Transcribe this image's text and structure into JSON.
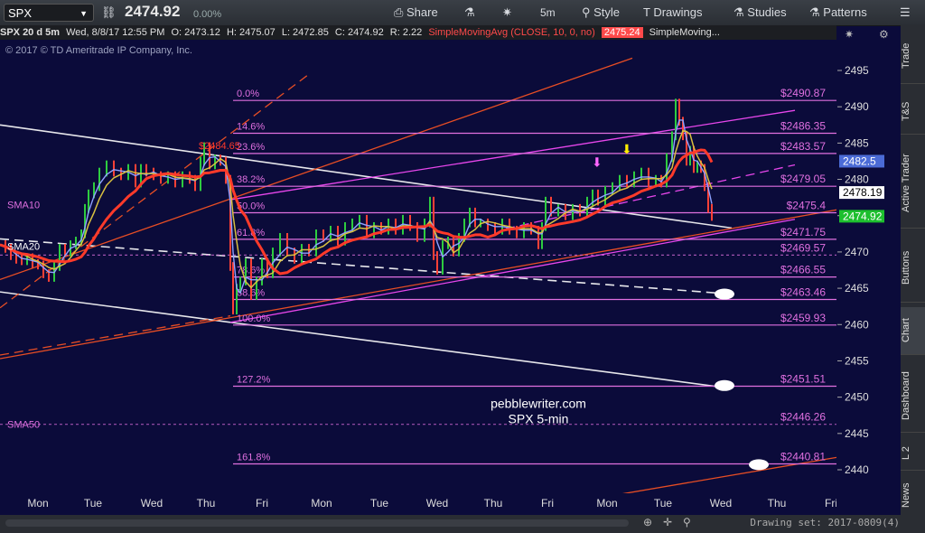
{
  "toolbar": {
    "symbol": "SPX",
    "last_price": "2474.92",
    "change_pct": "0.00%",
    "buttons": [
      "Share",
      "5m",
      "Style",
      "Drawings",
      "Studies",
      "Patterns"
    ]
  },
  "infobar": {
    "chart_desc": "SPX 20 d 5m",
    "datetime": "Wed, 8/8/17 12:55 PM",
    "open": "O: 2473.12",
    "high": "H: 2475.07",
    "low": "L: 2472.85",
    "close": "C: 2474.92",
    "range": "R: 2.22",
    "sma_label": "SimpleMovingAvg (CLOSE, 10, 0, no)",
    "sma_value": "2475.24",
    "sma2_label": "SimpleMoving..."
  },
  "copyright": "© 2017 © TD Ameritrade IP Company, Inc.",
  "watermark": [
    "pebblewriter.com",
    "SPX 5-min"
  ],
  "side_tabs": [
    "Trade",
    "T&S",
    "Active Trader",
    "Buttons",
    "Chart",
    "Dashboard",
    "L 2",
    "News"
  ],
  "drawing_set": "Drawing set: 2017-0809(4)",
  "colors": {
    "background": "#0b0b3a",
    "fib": "#e070e0",
    "sma10": "#ff3a2a",
    "price_badge": "#1dbf2e",
    "accent_blue": "#4b6bd6"
  },
  "chart_data": {
    "type": "line",
    "y_ticks": [
      2440,
      2445,
      2450,
      2455,
      2460,
      2465,
      2470,
      2475,
      2480,
      2485,
      2490,
      2495
    ],
    "ylim": [
      2437.5,
      2497.5
    ],
    "x_labels": [
      "Mon",
      "Tue",
      "Wed",
      "Thu",
      "Fri",
      "Mon",
      "Tue",
      "Wed",
      "Thu",
      "Fri",
      "Mon",
      "Tue",
      "Wed",
      "Thu",
      "Fri"
    ],
    "fib_levels": [
      {
        "pct": "0.0%",
        "price": 2490.87,
        "label": "$2490.87"
      },
      {
        "pct": "14.6%",
        "price": 2486.35,
        "label": "$2486.35"
      },
      {
        "pct": "23.6%",
        "price": 2483.57,
        "label": "$2483.57"
      },
      {
        "pct": "38.2%",
        "price": 2479.05,
        "label": "$2479.05"
      },
      {
        "pct": "50.0%",
        "price": 2475.4,
        "label": "$2475.4"
      },
      {
        "pct": "61.8%",
        "price": 2471.75,
        "label": "$2471.75"
      },
      {
        "pct": "",
        "price": 2469.57,
        "label": "$2469.57"
      },
      {
        "pct": "78.6%",
        "price": 2466.55,
        "label": "$2466.55"
      },
      {
        "pct": "88.6%",
        "price": 2463.46,
        "label": "$2463.46"
      },
      {
        "pct": "100.0%",
        "price": 2459.93,
        "label": "$2459.93"
      },
      {
        "pct": "127.2%",
        "price": 2451.51,
        "label": "$2451.51"
      },
      {
        "pct": "",
        "price": 2446.26,
        "label": "$2446.26"
      },
      {
        "pct": "161.8%",
        "price": 2440.81,
        "label": "$2440.81"
      }
    ],
    "sma_labels": [
      {
        "name": "SMA10",
        "price": 2476.5
      },
      {
        "name": "SMA20",
        "price": 2470.8
      },
      {
        "name": "SMA50",
        "price": 2446.3
      }
    ],
    "annotation": {
      "label": "$2484.65",
      "price": 2484.65
    },
    "price_badges": [
      {
        "value": "2482.5",
        "price": 2482.5,
        "color": "#4b6bd6"
      },
      {
        "value": "2478.19",
        "price": 2478.19,
        "color": "#ffffff"
      },
      {
        "value": "2474.92",
        "price": 2474.92,
        "color": "#1dbf2e"
      }
    ],
    "price_path": [
      [
        0,
        2471
      ],
      [
        6,
        2470.5
      ],
      [
        12,
        2469.5
      ],
      [
        18,
        2469
      ],
      [
        24,
        2468.8
      ],
      [
        30,
        2469.2
      ],
      [
        36,
        2468.4
      ],
      [
        42,
        2468.2
      ],
      [
        48,
        2467
      ],
      [
        54,
        2466.5
      ],
      [
        60,
        2468
      ],
      [
        66,
        2470.5
      ],
      [
        72,
        2470
      ],
      [
        78,
        2471
      ],
      [
        84,
        2471.5
      ],
      [
        90,
        2472.5
      ],
      [
        94,
        2476
      ],
      [
        98,
        2478
      ],
      [
        104,
        2479
      ],
      [
        110,
        2481
      ],
      [
        118,
        2482
      ],
      [
        126,
        2481
      ],
      [
        134,
        2480.5
      ],
      [
        142,
        2481.5
      ],
      [
        150,
        2479.5
      ],
      [
        156,
        2481.5
      ],
      [
        162,
        2481
      ],
      [
        170,
        2480.5
      ],
      [
        178,
        2480
      ],
      [
        186,
        2480.5
      ],
      [
        194,
        2479.5
      ],
      [
        202,
        2480.5
      ],
      [
        210,
        2480
      ],
      [
        216,
        2479
      ],
      [
        222,
        2482.5
      ],
      [
        226,
        2484.5
      ],
      [
        232,
        2482
      ],
      [
        238,
        2482.8
      ],
      [
        244,
        2482.5
      ],
      [
        250,
        2480
      ],
      [
        255,
        2468
      ],
      [
        258,
        2462
      ],
      [
        262,
        2465
      ],
      [
        266,
        2466
      ],
      [
        272,
        2468.5
      ],
      [
        278,
        2464
      ],
      [
        284,
        2466
      ],
      [
        290,
        2468.5
      ],
      [
        296,
        2467
      ],
      [
        302,
        2470
      ],
      [
        310,
        2472
      ],
      [
        318,
        2470
      ],
      [
        326,
        2469
      ],
      [
        334,
        2470.5
      ],
      [
        342,
        2470
      ],
      [
        350,
        2472.5
      ],
      [
        358,
        2472
      ],
      [
        366,
        2473
      ],
      [
        374,
        2471.5
      ],
      [
        382,
        2473.5
      ],
      [
        390,
        2474
      ],
      [
        398,
        2474.5
      ],
      [
        406,
        2472.5
      ],
      [
        414,
        2473.5
      ],
      [
        422,
        2473
      ],
      [
        430,
        2474
      ],
      [
        438,
        2473
      ],
      [
        446,
        2474.5
      ],
      [
        454,
        2473.5
      ],
      [
        462,
        2472
      ],
      [
        470,
        2474
      ],
      [
        476,
        2477
      ],
      [
        480,
        2469.5
      ],
      [
        484,
        2467.5
      ],
      [
        490,
        2471
      ],
      [
        496,
        2471.5
      ],
      [
        502,
        2470
      ],
      [
        508,
        2472
      ],
      [
        514,
        2474
      ],
      [
        520,
        2475.5
      ],
      [
        526,
        2474
      ],
      [
        532,
        2474
      ],
      [
        540,
        2473.5
      ],
      [
        548,
        2473
      ],
      [
        556,
        2474
      ],
      [
        564,
        2473
      ],
      [
        572,
        2472.5
      ],
      [
        580,
        2473.5
      ],
      [
        588,
        2473
      ],
      [
        596,
        2471
      ],
      [
        600,
        2473.5
      ],
      [
        604,
        2477
      ],
      [
        610,
        2475.5
      ],
      [
        618,
        2476
      ],
      [
        626,
        2475
      ],
      [
        634,
        2476
      ],
      [
        642,
        2475.5
      ],
      [
        650,
        2477
      ],
      [
        656,
        2478
      ],
      [
        662,
        2477
      ],
      [
        670,
        2478.5
      ],
      [
        678,
        2479
      ],
      [
        686,
        2480
      ],
      [
        694,
        2479.5
      ],
      [
        702,
        2480.5
      ],
      [
        710,
        2481
      ],
      [
        718,
        2479.5
      ],
      [
        726,
        2480
      ],
      [
        732,
        2479.5
      ],
      [
        738,
        2483
      ],
      [
        744,
        2486
      ],
      [
        748,
        2490.5
      ],
      [
        752,
        2488
      ],
      [
        756,
        2486
      ],
      [
        760,
        2482.5
      ],
      [
        764,
        2484
      ],
      [
        768,
        2481.5
      ],
      [
        772,
        2482
      ],
      [
        776,
        2481.5
      ],
      [
        780,
        2479
      ],
      [
        784,
        2476
      ],
      [
        788,
        2474.9
      ]
    ],
    "channel_lines": [
      {
        "color": "#ffffff",
        "dash": false,
        "from": [
          0,
          2487.5
        ],
        "to": [
          810,
          2473.3
        ]
      },
      {
        "color": "#ffffff",
        "dash": true,
        "from": [
          0,
          2471.8
        ],
        "to": [
          810,
          2464.2
        ]
      },
      {
        "color": "#ffffff",
        "dash": false,
        "from": [
          0,
          2464.5
        ],
        "to": [
          810,
          2451.2
        ]
      },
      {
        "color": "#ff4dff",
        "dash": false,
        "from": [
          255,
          2460.3
        ],
        "to": [
          880,
          2474.5
        ]
      },
      {
        "color": "#ff4dff",
        "dash": false,
        "from": [
          255,
          2477.2
        ],
        "to": [
          880,
          2489.5
        ]
      },
      {
        "color": "#ff4dff",
        "dash": true,
        "from": [
          560,
          2473.2
        ],
        "to": [
          880,
          2482
        ]
      },
      {
        "color": "#ff5522",
        "dash": false,
        "from": [
          0,
          2455.3
        ],
        "to": [
          926,
          2475.8
        ]
      },
      {
        "color": "#ff5522",
        "dash": false,
        "from": [
          0,
          2466.2
        ],
        "to": [
          700,
          2496.7
        ]
      },
      {
        "color": "#ff5522",
        "dash": false,
        "from": [
          600,
          2434.8
        ],
        "to": [
          926,
          2441.7
        ]
      },
      {
        "color": "#ff5522",
        "dash": true,
        "from": [
          0,
          2455.8
        ],
        "to": [
          255,
          2461.2
        ]
      },
      {
        "color": "#ff5522",
        "dash": true,
        "from": [
          0,
          2462.3
        ],
        "to": [
          340,
          2494.3
        ]
      }
    ]
  }
}
